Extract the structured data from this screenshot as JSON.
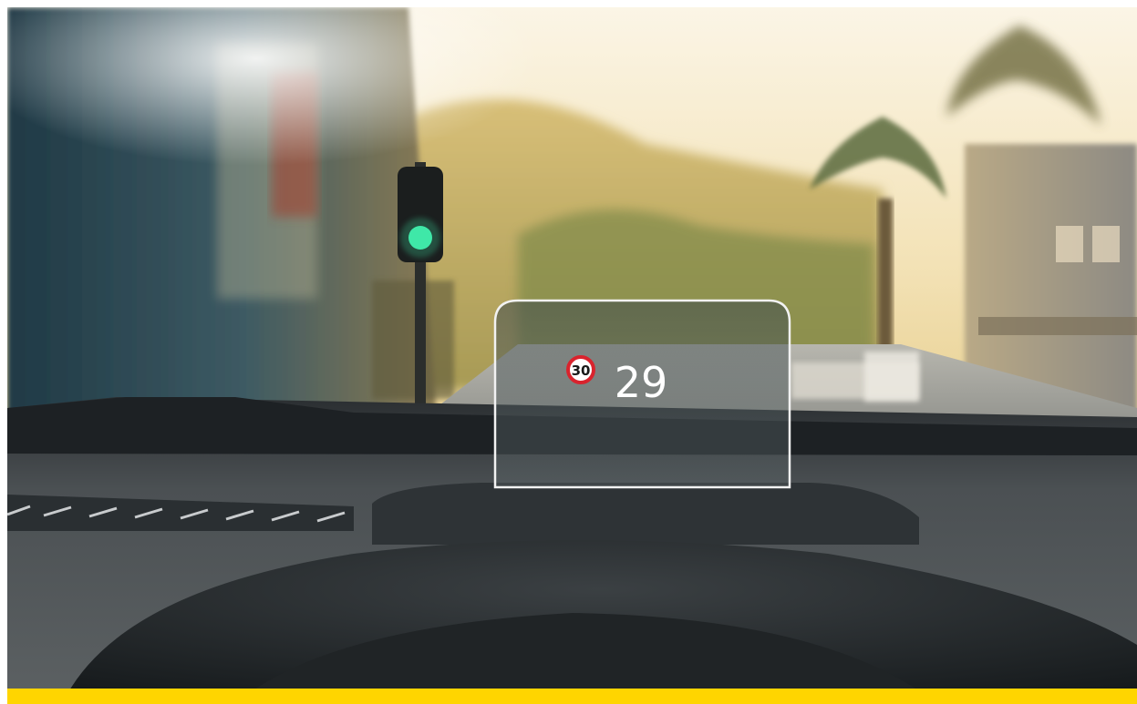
{
  "hud": {
    "speed_limit": "30",
    "current_speed": "29"
  },
  "colors": {
    "accent_bar": "#FFD500",
    "sign_red": "#d9232d",
    "traffic_light_green": "#3fe8a8"
  }
}
